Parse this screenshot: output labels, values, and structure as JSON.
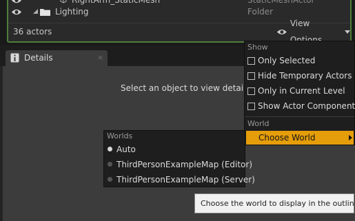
{
  "outliner": {
    "rows": [
      {
        "name": "RightArm_StaticMesh",
        "type": "StaticMeshActor"
      },
      {
        "name": "Lighting",
        "type": "Folder"
      }
    ],
    "actor_count": "36 actors",
    "view_options_label": "View Options"
  },
  "details": {
    "tab_label": "Details",
    "tab_close": "×",
    "empty_message": "Select an object to view details."
  },
  "view_menu": {
    "show_header": "Show",
    "items": [
      {
        "label": "Only Selected",
        "checked": false
      },
      {
        "label": "Hide Temporary Actors",
        "checked": false
      },
      {
        "label": "Only in Current Level",
        "checked": false
      },
      {
        "label": "Show Actor Components",
        "checked": false
      }
    ],
    "world_header": "World",
    "choose_world_label": "Choose World"
  },
  "worlds_submenu": {
    "header": "Worlds",
    "options": [
      {
        "label": "Auto",
        "selected": true
      },
      {
        "label": "ThirdPersonExampleMap (Editor)",
        "selected": false
      },
      {
        "label": "ThirdPersonExampleMap (Server)",
        "selected": false
      }
    ]
  },
  "tooltip": {
    "text": "Choose the world to display in the outliner."
  },
  "colors": {
    "accent": "#e59d0a",
    "selection_border": "#4e7f3c"
  }
}
